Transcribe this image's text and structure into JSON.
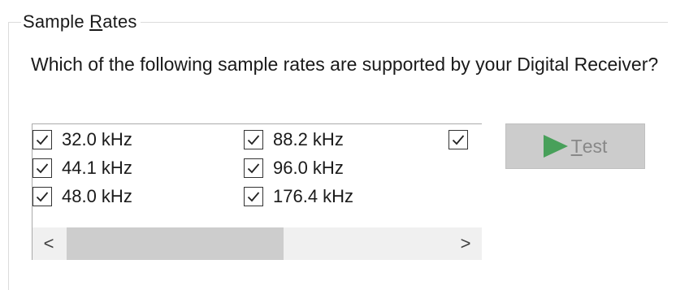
{
  "group": {
    "title_mnemonic_char": "R",
    "title_prefix": "Sample ",
    "title_suffix": "ates"
  },
  "question": "Which of the following sample rates are supported by your Digital Receiver?",
  "rates": [
    {
      "label": "32.0 kHz",
      "checked": true
    },
    {
      "label": "44.1 kHz",
      "checked": true
    },
    {
      "label": "48.0 kHz",
      "checked": true
    },
    {
      "label": "88.2 kHz",
      "checked": true
    },
    {
      "label": "96.0 kHz",
      "checked": true
    },
    {
      "label": "176.4 kHz",
      "checked": true
    },
    {
      "label": "",
      "checked": true
    }
  ],
  "scrollbar": {
    "left_arrow": "<",
    "right_arrow": ">",
    "thumb_fraction": 0.57
  },
  "test_button": {
    "mnemonic_char": "T",
    "label_rest": "est",
    "enabled": false
  },
  "colors": {
    "play_icon": "#48a05a",
    "button_disabled_bg": "#cccccc",
    "scroll_track": "#f0f0f0",
    "scroll_thumb": "#cdcdcd"
  }
}
